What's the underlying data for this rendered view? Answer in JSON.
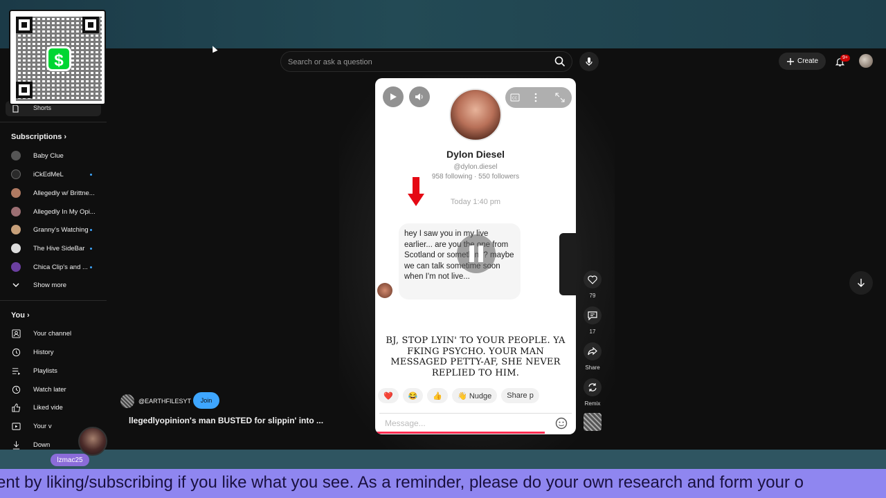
{
  "overlay": {
    "qr_logo": "$",
    "streamer_name": "lzmac25",
    "ticker_text": "ent by liking/subscribing if you like what you see. As a reminder, please do your own research and form your o"
  },
  "masthead": {
    "search_placeholder": "Search or ask a question",
    "create_label": "Create",
    "notification_badge": "9+"
  },
  "sidebar": {
    "shorts_label": "Shorts",
    "subscriptions_title": "Subscriptions",
    "subscriptions": [
      {
        "label": "Baby Clue",
        "color": "#555555"
      },
      {
        "label": "iCkEdMeL",
        "color": "#2a2a2a"
      },
      {
        "label": "Allegedly w/ Brittne...",
        "color": "#b07a62"
      },
      {
        "label": "Allegedly In My Opi...",
        "color": "#9c6f73"
      },
      {
        "label": "Granny's Watching",
        "color": "#c7a07a"
      },
      {
        "label": "The Hive SideBar",
        "color": "#dddddd"
      },
      {
        "label": "Chica Clip's and ...",
        "color": "#6b3fa0"
      }
    ],
    "show_more": "Show more",
    "you_title": "You",
    "you_items": [
      "Your channel",
      "History",
      "Playlists",
      "Watch later",
      "Liked vide",
      "Your v",
      "Down"
    ]
  },
  "video": {
    "profile_name": "Dylon Diesel",
    "profile_handle": "@dylon.diesel",
    "profile_stats": "958 following · 550 followers",
    "chat_time": "Today 1:40 pm",
    "message": "hey I saw you in my live earlier... are you the one from Scotland or something? maybe we can talk sometime soon when I'm not live...",
    "caption": "BJ, STOP LYIN' TO YOUR PEOPLE. YA FKING PSYCHO. YOUR MAN MESSAGED PETTY-AF, SHE NEVER REPLIED TO HIM.",
    "reactions": [
      "❤️",
      "😂",
      "👍",
      "👋 Nudge",
      "Share p"
    ],
    "message_placeholder": "Message..."
  },
  "rail": {
    "likes": "79",
    "comments": "17",
    "share": "Share",
    "remix": "Remix"
  },
  "channel": {
    "name": "@EARTHFILESYT",
    "join": "Join",
    "title": "llegedlyopinion's man BUSTED for slippin' into ..."
  }
}
